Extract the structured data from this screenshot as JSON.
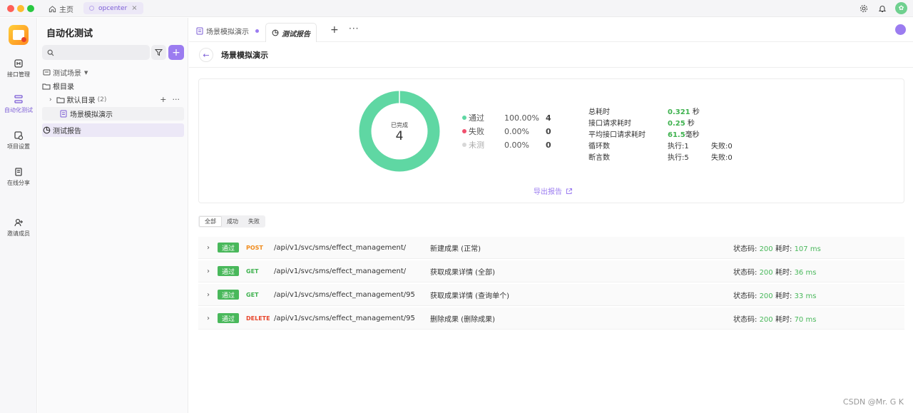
{
  "titlebar": {
    "home_label": "主页",
    "project_tab": "opcenter"
  },
  "rail": {
    "items": [
      {
        "label": "接口管理",
        "icon": "api-icon"
      },
      {
        "label": "自动化测试",
        "icon": "automation-icon"
      },
      {
        "label": "项目设置",
        "icon": "settings-icon"
      },
      {
        "label": "在线分享",
        "icon": "share-icon"
      },
      {
        "label": "邀请成员",
        "icon": "invite-icon"
      }
    ]
  },
  "sidebar": {
    "title": "自动化测试",
    "search_placeholder": "",
    "scenes_label": "测试场景",
    "root_label": "根目录",
    "default_dir_label": "默认目录",
    "default_dir_count": "(2)",
    "scene_item": "场景模拟演示",
    "report_label": "测试报告"
  },
  "tabs": {
    "tab1": "场景模拟演示",
    "tab2": "测试报告"
  },
  "main": {
    "title": "场景模拟演示",
    "donut_label": "已完成",
    "donut_total": "4",
    "legend": [
      {
        "name": "通过",
        "pct": "100.00%",
        "count": "4",
        "color": "#5fd7a3"
      },
      {
        "name": "失败",
        "pct": "0.00%",
        "count": "0",
        "color": "#f0506e"
      },
      {
        "name": "未测",
        "pct": "0.00%",
        "count": "0",
        "color": "#d8d8d8"
      }
    ],
    "stats": {
      "total_time_label": "总耗时",
      "total_time_value": "0.321",
      "total_time_unit": " 秒",
      "req_time_label": "接口请求耗时",
      "req_time_value": "0.25",
      "req_time_unit": " 秒",
      "avg_time_label": "平均接口请求耗时",
      "avg_time_value": "61.5",
      "avg_time_unit": "毫秒",
      "loop_label": "循环数",
      "loop_exec": "执行:1",
      "loop_fail": "失败:0",
      "assert_label": "断言数",
      "assert_exec": "执行:5",
      "assert_fail": "失败:0"
    },
    "export_label": "导出报告",
    "filters": [
      "全部",
      "成功",
      "失败"
    ],
    "requests": [
      {
        "badge": "通过",
        "method": "POST",
        "method_color": "#f08c1e",
        "path": "/api/v1/svc/sms/effect_management/",
        "name": "新建成果 (正常)",
        "status_label": "状态码:",
        "status_code": "200",
        "time_label": "耗时:",
        "time_value": "107 ms"
      },
      {
        "badge": "通过",
        "method": "GET",
        "method_color": "#3fb24f",
        "path": "/api/v1/svc/sms/effect_management/",
        "name": "获取成果详情 (全部)",
        "status_label": "状态码:",
        "status_code": "200",
        "time_label": "耗时:",
        "time_value": "36 ms"
      },
      {
        "badge": "通过",
        "method": "GET",
        "method_color": "#3fb24f",
        "path": "/api/v1/svc/sms/effect_management/95",
        "name": "获取成果详情 (查询单个)",
        "status_label": "状态码:",
        "status_code": "200",
        "time_label": "耗时:",
        "time_value": "33 ms"
      },
      {
        "badge": "通过",
        "method": "DELETE",
        "method_color": "#e8452b",
        "path": "/api/v1/svc/sms/effect_management/95",
        "name": "删除成果 (删除成果)",
        "status_label": "状态码:",
        "status_code": "200",
        "time_label": "耗时:",
        "time_value": "70 ms"
      }
    ]
  },
  "watermark": "CSDN @Mr. G K",
  "colors": {
    "accent": "#9b7cf0",
    "success": "#49b85b",
    "donut": "#5fd7a3"
  }
}
